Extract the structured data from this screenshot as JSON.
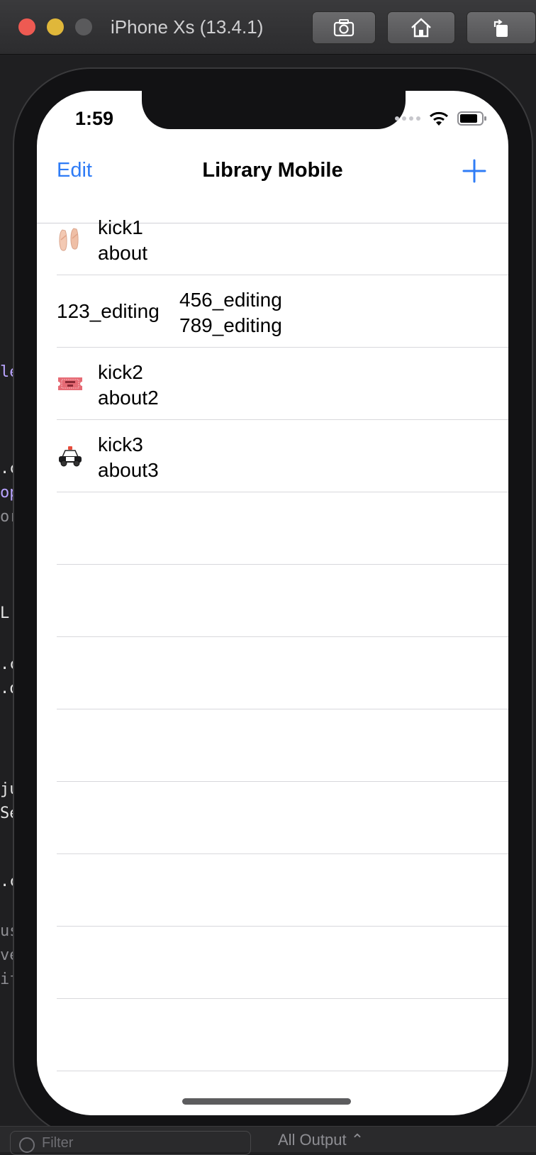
{
  "simulator": {
    "title": "iPhone Xs (13.4.1)",
    "buttons": [
      "screenshot-icon",
      "home-icon",
      "rotate-icon"
    ]
  },
  "status_bar": {
    "time": "1:59"
  },
  "nav": {
    "edit_label": "Edit",
    "title": "Library Mobile"
  },
  "rows": [
    {
      "kind": "item",
      "icon": "ballet-shoes-icon",
      "title": "kick1",
      "subtitle": "about"
    },
    {
      "kind": "editing",
      "left": "123_editing",
      "right_top": "456_editing",
      "right_bottom": "789_editing"
    },
    {
      "kind": "item",
      "icon": "ticket-icon",
      "title": "kick2",
      "subtitle": "about2"
    },
    {
      "kind": "item",
      "icon": "police-car-icon",
      "title": "kick3",
      "subtitle": "about3"
    }
  ],
  "bottom_bar": {
    "filter_placeholder": "Filter",
    "output_label": "All Output"
  },
  "colors": {
    "accent": "#2f7cf6"
  }
}
